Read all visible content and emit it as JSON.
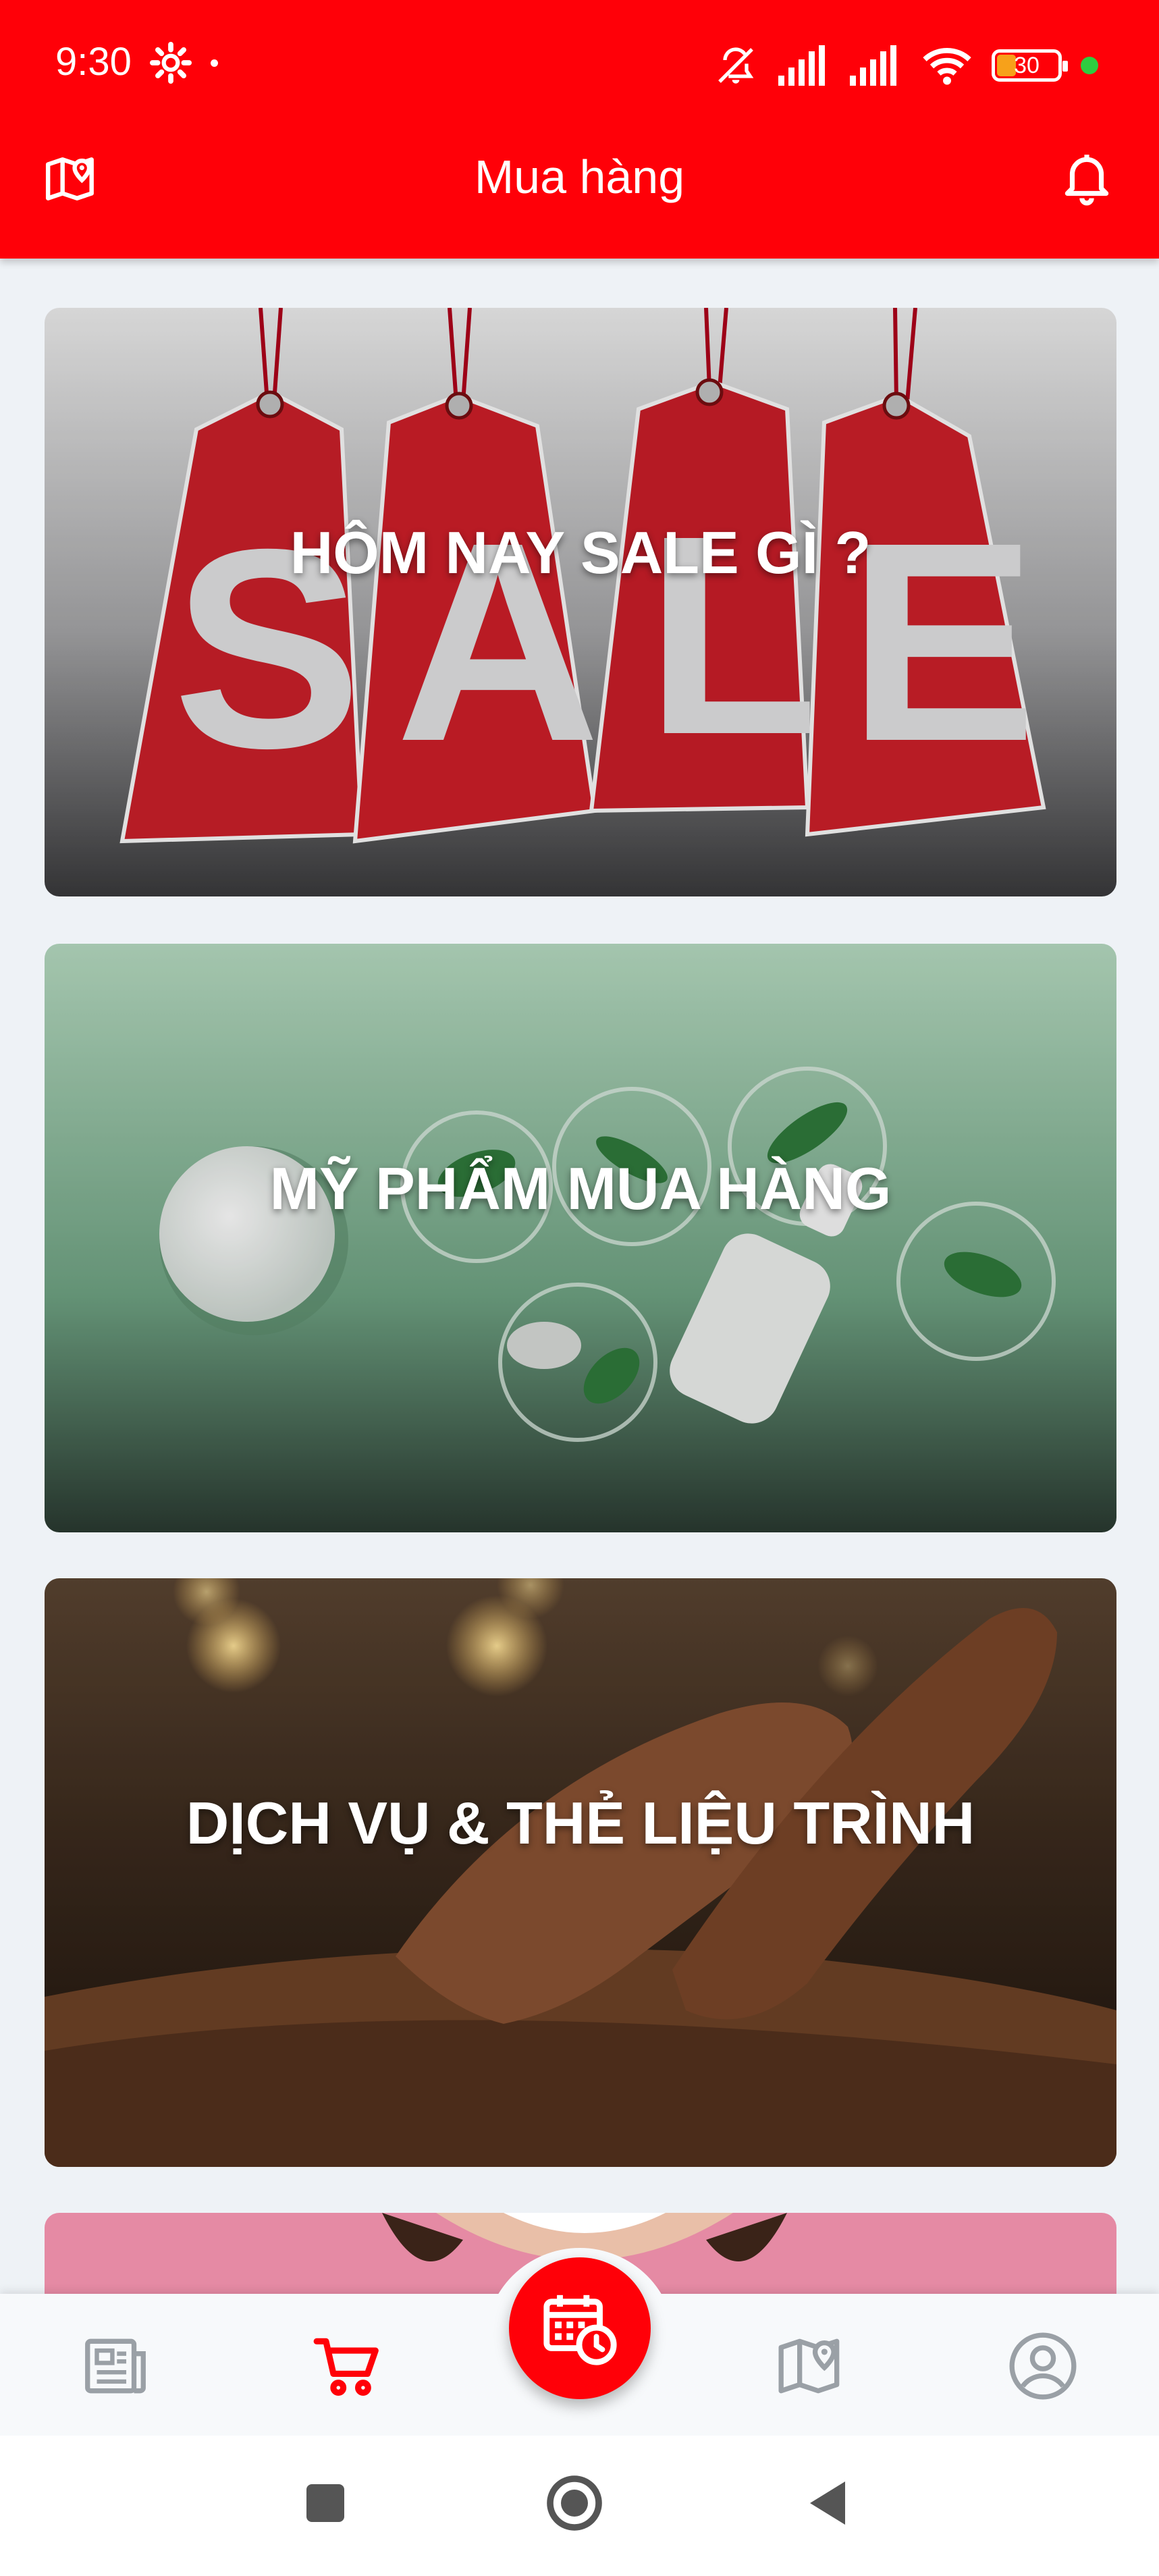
{
  "status_bar": {
    "time": "9:30",
    "battery_level": "30",
    "icons": [
      "gear-icon",
      "mute-vibrate-icon",
      "signal-icon",
      "signal-icon",
      "wifi-icon",
      "battery-icon"
    ]
  },
  "app_bar": {
    "title": "Mua hàng",
    "left_icon": "map-pin-icon",
    "right_icon": "bell-icon"
  },
  "categories": [
    {
      "title": "HÔM NAY SALE GÌ ?",
      "image": "sale-tags"
    },
    {
      "title": "MỸ PHẨM MUA HÀNG",
      "image": "cosmetics"
    },
    {
      "title": "DỊCH VỤ & THẺ LIỆU TRÌNH",
      "image": "massage"
    },
    {
      "title": "",
      "image": "woman-smile"
    }
  ],
  "bottom_nav": {
    "items": [
      {
        "icon": "newspaper-icon",
        "active": false
      },
      {
        "icon": "cart-icon",
        "active": true
      },
      {
        "icon": "calendar-clock-icon",
        "active": false,
        "center": true
      },
      {
        "icon": "map-icon",
        "active": false
      },
      {
        "icon": "profile-icon",
        "active": false
      }
    ]
  },
  "colors": {
    "primary": "#ff0008",
    "background": "#eef2f6",
    "inactive_icon": "#9aa0a6"
  }
}
